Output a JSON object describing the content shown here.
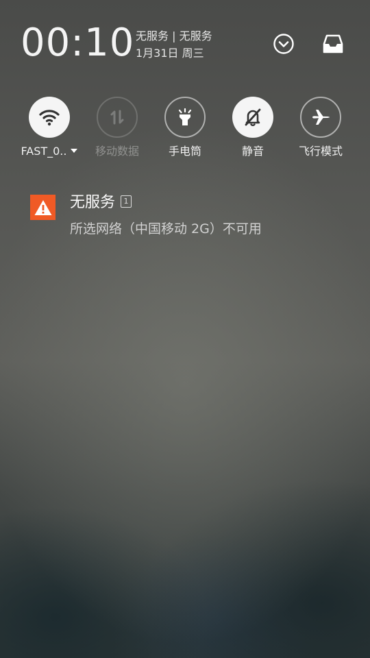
{
  "header": {
    "time": "00:10",
    "carrier_line": "无服务 | 无服务",
    "date_line": "1月31日 周三",
    "expand_icon": "chevron-down-circle-icon",
    "inbox_icon": "inbox-tray-icon"
  },
  "quick_settings": [
    {
      "label": "FAST_0..",
      "icon": "wifi-icon",
      "state": "on",
      "has_dropdown": true
    },
    {
      "label": "移动数据",
      "icon": "mobile-data-icon",
      "state": "disabled"
    },
    {
      "label": "手电筒",
      "icon": "flashlight-icon",
      "state": "off"
    },
    {
      "label": "静音",
      "icon": "bell-mute-icon",
      "state": "on"
    },
    {
      "label": "飞行模式",
      "icon": "airplane-icon",
      "state": "off"
    }
  ],
  "notification": {
    "icon": "warning-icon",
    "title": "无服务",
    "sim_badge": "1",
    "body": "所选网络（中国移动 2G）不可用",
    "accent_color": "#f05a25"
  }
}
